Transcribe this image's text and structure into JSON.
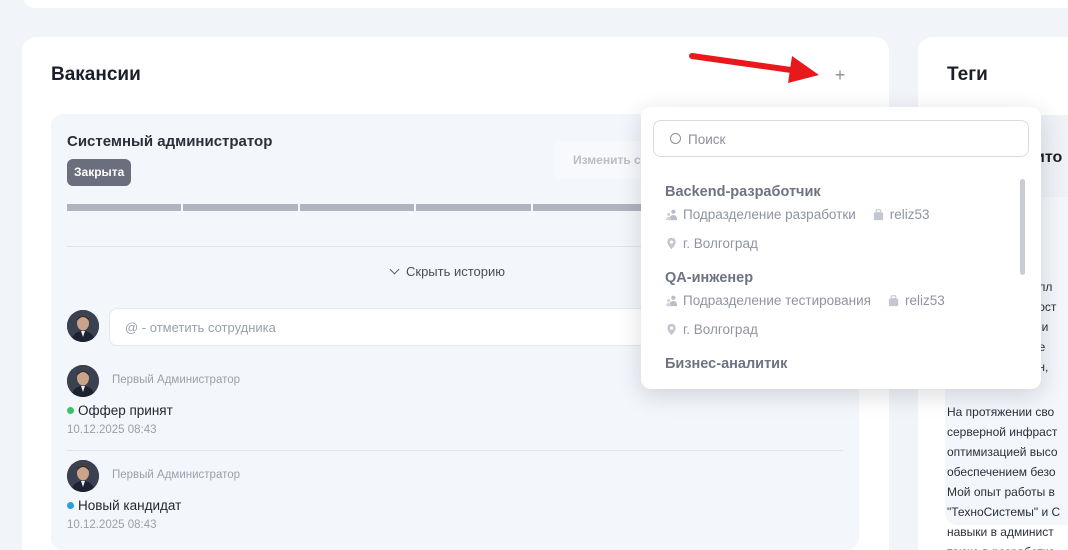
{
  "vacancies": {
    "title": "Вакансии",
    "add_label": "+",
    "card": {
      "title": "Системный администратор",
      "status": "Закрыта",
      "edit_button": "Изменить с",
      "progress_segments": 5,
      "history_toggle": "Скрыть историю",
      "mention_placeholder": "@ - отметить сотрудника",
      "events": [
        {
          "author": "Первый Администратор",
          "status": "Оффер принят",
          "status_color": "#3cc06a",
          "date": "10.12.2025 08:43"
        },
        {
          "author": "Первый Администратор",
          "status": "Новый кандидат",
          "status_color": "#2a9fe0",
          "date": "10.12.2025 08:43"
        }
      ]
    }
  },
  "tags": {
    "title": "Теги",
    "heading_fragment": "ито",
    "lines_right": "рилл\nнност\nра и \nлее \nрен, ",
    "paragraph": "На протяжении сво\nсерверной инфраст\nоптимизацией высо\nобеспечением безо\nМой опыт работы в\n\"ТехноСистемы\" и С\nнавыки в админист\nтакже в разработке"
  },
  "dropdown": {
    "search_placeholder": "Поиск",
    "items": [
      {
        "title": "Backend-разработчик",
        "department": "Подразделение разработки",
        "company": "reliz53",
        "city": "г. Волгоград"
      },
      {
        "title": "QA-инженер",
        "department": "Подразделение тестирования",
        "company": "reliz53",
        "city": "г. Волгоград"
      },
      {
        "title": "Бизнес-аналитик"
      }
    ]
  },
  "colors": {
    "accent": "#3b82f6",
    "arrow": "#e8191b",
    "badge_bg": "#6b6e7c"
  }
}
